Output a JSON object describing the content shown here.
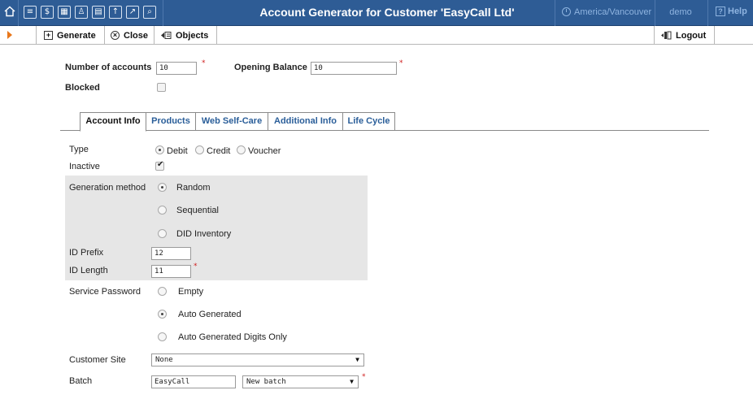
{
  "header": {
    "title": "Account Generator for Customer 'EasyCall Ltd'",
    "timezone": "America/Vancouver",
    "user": "demo",
    "help": "Help"
  },
  "toolbar": {
    "generate_label": "Generate",
    "close_label": "Close",
    "objects_label": "Objects",
    "logout_label": "Logout"
  },
  "form": {
    "num_accounts_label": "Number of accounts",
    "num_accounts_value": "10",
    "opening_balance_label": "Opening Balance",
    "opening_balance_value": "10",
    "blocked_label": "Blocked"
  },
  "tabs": [
    {
      "label": "Account Info",
      "active": true
    },
    {
      "label": "Products"
    },
    {
      "label": "Web Self-Care"
    },
    {
      "label": "Additional Info"
    },
    {
      "label": "Life Cycle"
    }
  ],
  "account_info": {
    "type_label": "Type",
    "type_options": [
      "Debit",
      "Credit",
      "Voucher"
    ],
    "type_selected": "Debit",
    "inactive_label": "Inactive",
    "inactive_checked": true,
    "gen_method_label": "Generation method",
    "gen_method_options": [
      "Random",
      "Sequential",
      "DID Inventory"
    ],
    "gen_method_selected": "Random",
    "id_prefix_label": "ID Prefix",
    "id_prefix_value": "12",
    "id_length_label": "ID Length",
    "id_length_value": "11",
    "service_password_label": "Service Password",
    "service_password_options": [
      "Empty",
      "Auto Generated",
      "Auto Generated Digits Only"
    ],
    "service_password_selected": "Auto Generated",
    "customer_site_label": "Customer Site",
    "customer_site_value": "None",
    "batch_label": "Batch",
    "batch_value": "EasyCall",
    "batch_select_value": "New batch"
  },
  "colors": {
    "header_bg": "#2e5c95",
    "accent_orange": "#e8771b",
    "tab_link": "#2a5e99",
    "required": "#d02020",
    "gray_section": "#e6e6e6"
  }
}
